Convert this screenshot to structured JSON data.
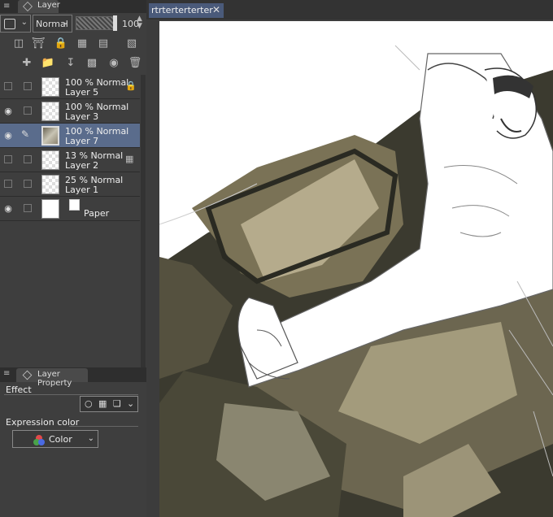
{
  "panel": {
    "tab_label": "Layer",
    "blend_mode": "Normal",
    "opacity": "100",
    "opacity_fraction": 1.0
  },
  "layers": [
    {
      "mode": "100 % Normal",
      "name": "Layer 5",
      "visible": false,
      "locked": true
    },
    {
      "mode": "100 % Normal",
      "name": "Layer 3",
      "visible": true
    },
    {
      "mode": "100 % Normal",
      "name": "Layer 7",
      "visible": true,
      "selected": true
    },
    {
      "mode": "13 % Normal",
      "name": "Layer 2",
      "visible": false
    },
    {
      "mode": "25 % Normal",
      "name": "Layer 1",
      "visible": false
    },
    {
      "name": "Paper",
      "visible": true
    }
  ],
  "property": {
    "tab_label": "Layer Property",
    "effect_label": "Effect",
    "expression_label": "Expression color",
    "color_value": "Color"
  },
  "document": {
    "tab_label": "rtrterterterter"
  },
  "colors": {
    "selection": "#5a6c8c",
    "panel_bg": "#3e3e3e",
    "doc_tab": "#4a5a7a",
    "couch_dark": "#3b3a2f",
    "couch_mid": "#7a7256",
    "couch_light": "#b5ab8c"
  }
}
